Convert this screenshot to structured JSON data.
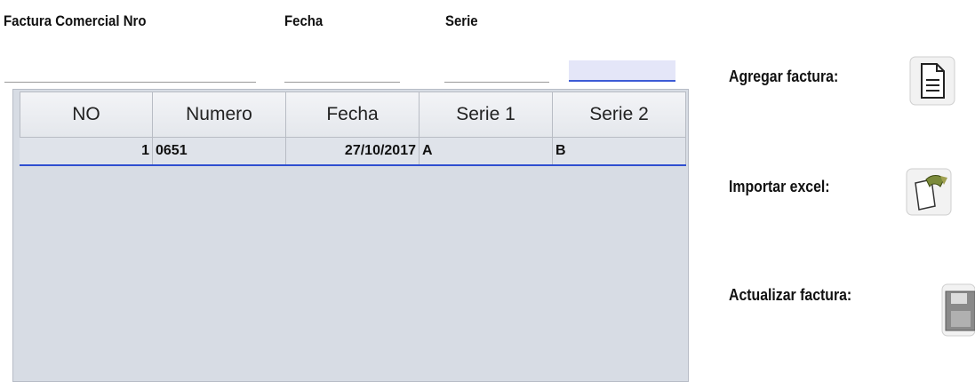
{
  "form": {
    "factura_label": "Factura Comercial Nro",
    "fecha_label": "Fecha",
    "serie_label": "Serie",
    "factura_value": "",
    "fecha_value": "",
    "serie1_value": "",
    "serie2_value": ""
  },
  "table": {
    "headers": [
      "NO",
      "Numero",
      "Fecha",
      "Serie 1",
      "Serie 2"
    ],
    "rows": [
      {
        "no": "1",
        "numero": "0651",
        "fecha": "27/10/2017",
        "serie1": "A",
        "serie2": "B"
      }
    ]
  },
  "actions": {
    "agregar_label": "Agregar factura:",
    "importar_label": "Importar excel:",
    "actualizar_label": "Actualizar factura:"
  },
  "icons": {
    "agregar": "document-icon",
    "importar": "import-excel-icon",
    "actualizar": "save-icon"
  },
  "colors": {
    "selection_border": "#2f4fd0",
    "table_bg": "#d7dce4"
  }
}
